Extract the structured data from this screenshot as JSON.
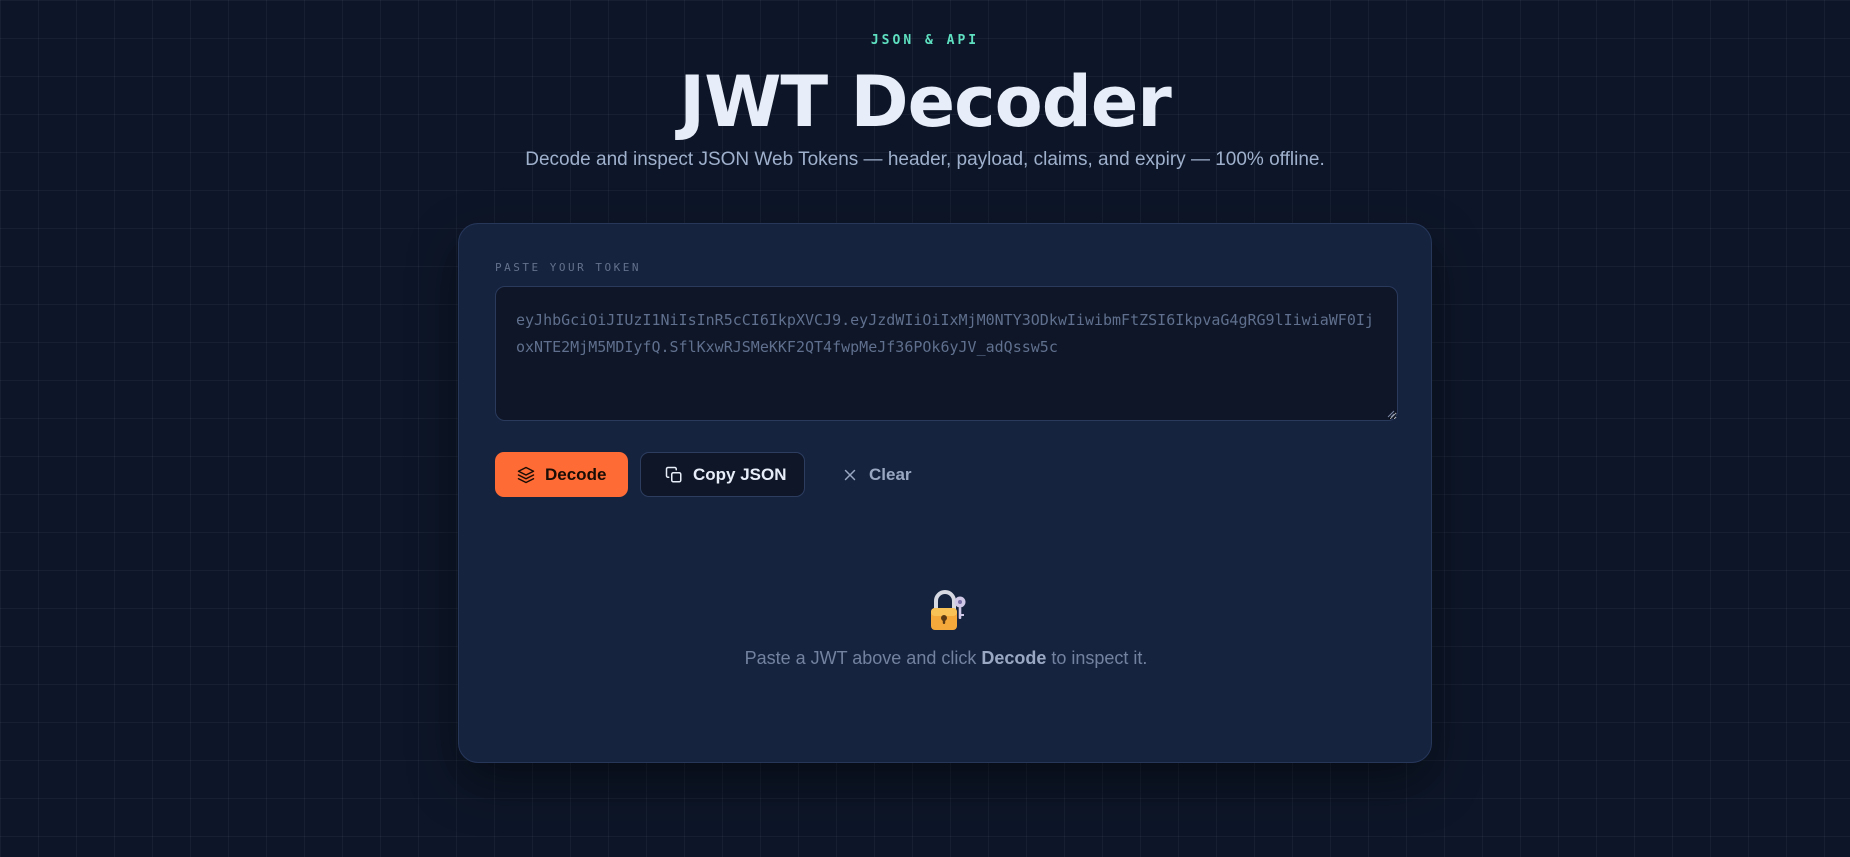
{
  "header": {
    "eyebrow": "JSON & API",
    "title": "JWT Decoder",
    "subtitle": "Decode and inspect JSON Web Tokens — header, payload, claims, and expiry — 100% offline."
  },
  "card": {
    "field_label": "PASTE YOUR TOKEN",
    "token_placeholder": "eyJhbGciOiJIUzI1NiIsInR5cCI6IkpXVCJ9.eyJzdWIiOiIxMjM0NTY3ODkwIiwibmFtZSI6IkpvaG4gRG9lIiwiaWF0IjoxNTE2MjM5MDIyfQ.SflKxwRJSMeKKF2QT4fwpMeJf36POk6yJV_adQssw5c",
    "buttons": {
      "decode": "Decode",
      "copy": "Copy JSON",
      "clear": "Clear"
    },
    "empty_state": {
      "icon": "lock-with-key-icon",
      "text_before": "Paste a JWT above and click ",
      "text_bold": "Decode",
      "text_after": " to inspect it."
    }
  },
  "colors": {
    "accent": "#ff6b35",
    "eyebrow": "#5ee0c1",
    "background": "#0d1628",
    "card": "#15233f"
  }
}
